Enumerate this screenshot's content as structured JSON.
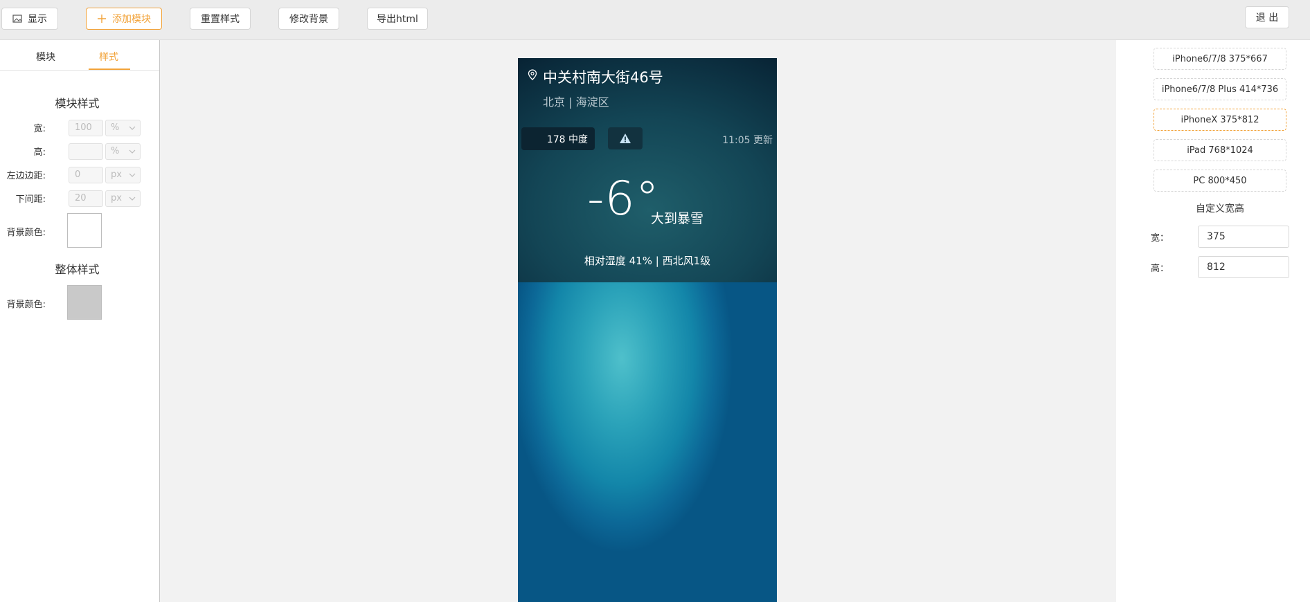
{
  "toolbar": {
    "show_label": "显示",
    "add_module_label": "添加模块",
    "reset_style_label": "重置样式",
    "change_bg_label": "修改背景",
    "export_label": "导出html",
    "exit_label": "退 出"
  },
  "left_panel": {
    "tabs": [
      "模块",
      "样式"
    ],
    "active_tab": "样式",
    "module_style_title": "模块样式",
    "fields": [
      {
        "label": "宽:",
        "value": "100",
        "unit": "%"
      },
      {
        "label": "高:",
        "value": "",
        "unit": "%"
      },
      {
        "label": "左边边距:",
        "value": "0",
        "unit": "px"
      },
      {
        "label": "下间距:",
        "value": "20",
        "unit": "px"
      }
    ],
    "bg_color_label": "背景颜色:",
    "module_bg_color": "#ffffff",
    "overall_style_title": "整体样式",
    "overall_bg_color_label": "背景颜色:",
    "overall_bg_color": "#c9c9c9"
  },
  "phone": {
    "address": "中关村南大街46号",
    "city": "北京 | 海淀区",
    "aqi": "178 中度",
    "update_time": "11:05 更新",
    "temperature": "-6°",
    "condition": "大到暴雪",
    "humidity_wind": "相对湿度 41% | 西北风1级"
  },
  "right_panel": {
    "devices": [
      "iPhone6/7/8 375*667",
      "iPhone6/7/8 Plus 414*736",
      "iPhoneX 375*812",
      "iPad 768*1024",
      "PC 800*450"
    ],
    "selected_device": "iPhoneX 375*812",
    "custom_title": "自定义宽高",
    "width_label": "宽：",
    "width_value": "375",
    "height_label": "高：",
    "height_value": "812"
  },
  "colors": {
    "accent": "#f2a33a"
  }
}
